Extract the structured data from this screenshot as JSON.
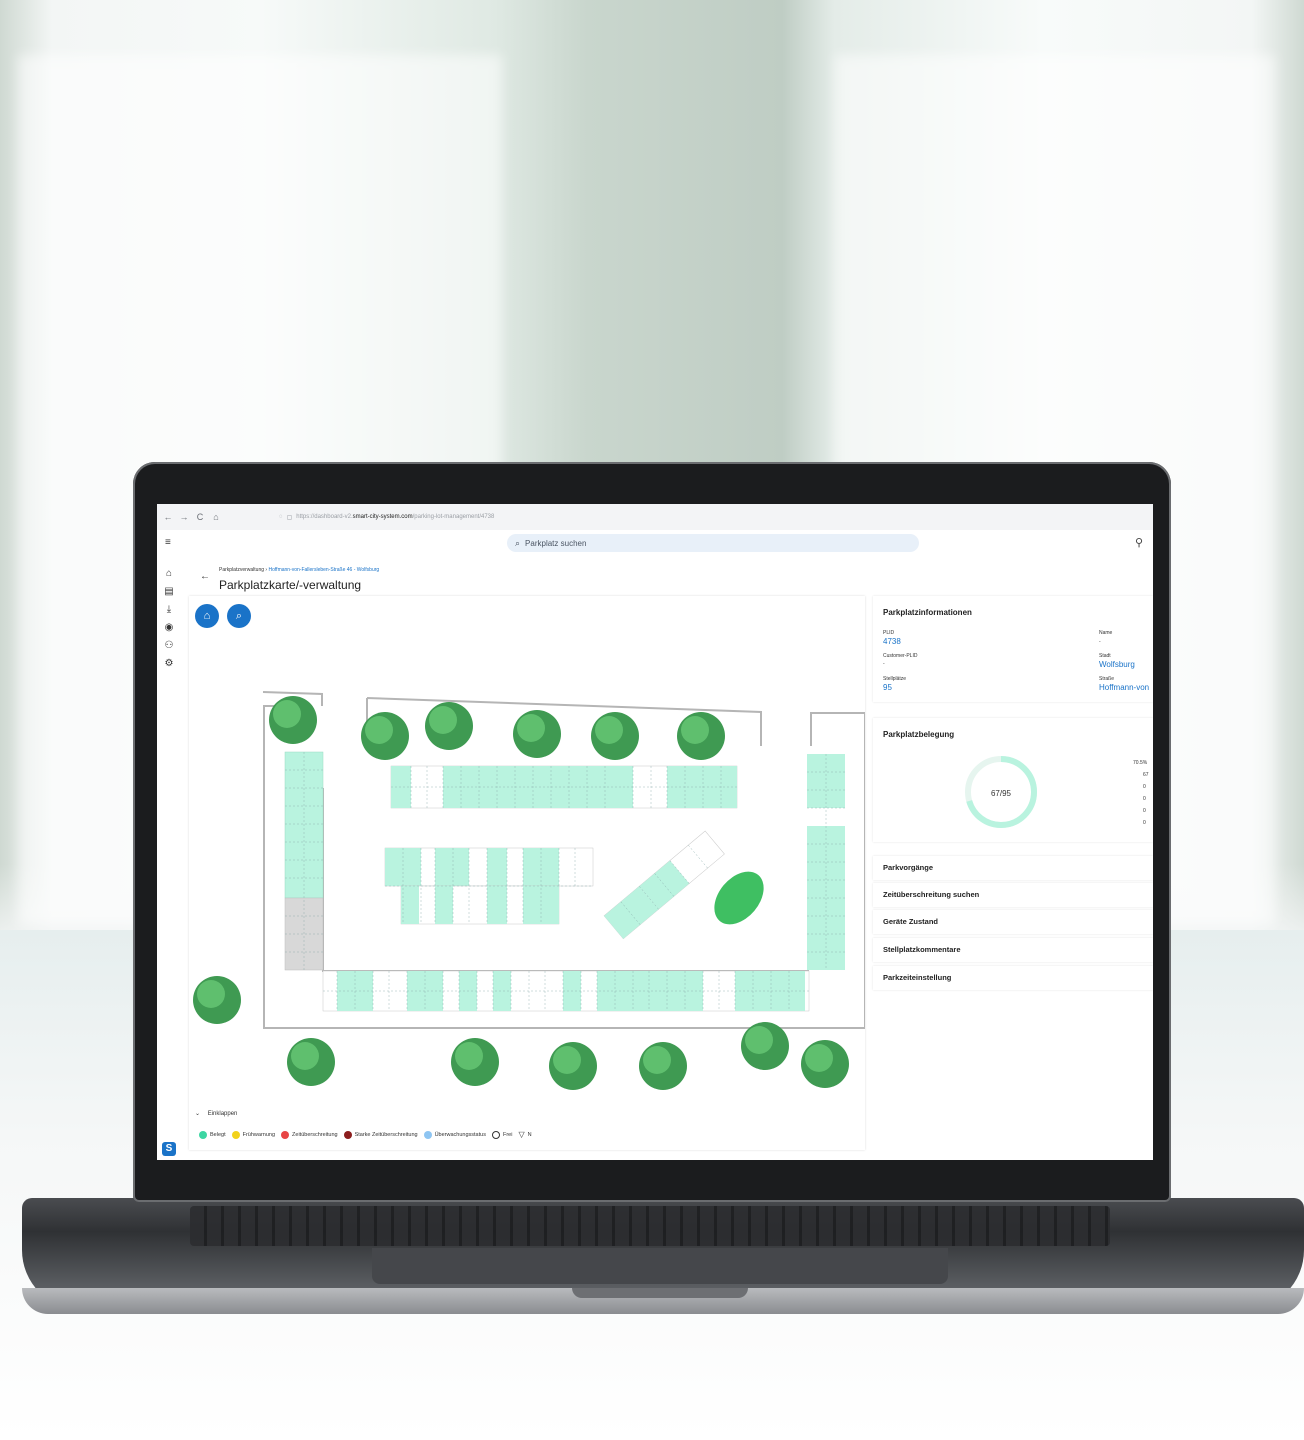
{
  "browser": {
    "url_prefix": "https://dashboard-v2.",
    "url_host": "smart-city-system.com",
    "url_path": "/parking-lot-management/4738",
    "nav_back": "←",
    "nav_forward": "→",
    "nav_reload": "C",
    "nav_home": "⌂"
  },
  "header": {
    "search_placeholder": "Parkplatz suchen"
  },
  "breadcrumb": {
    "root": "Parkplatzverwaltung",
    "separator": "›",
    "current": "Hoffmann-von-Fallersleben-Straße 46 - Wolfsburg"
  },
  "page_title": "Parkplatzkarte/-verwaltung",
  "map": {
    "collapse_label": "Einklappen",
    "legend": [
      {
        "label": "Belegt",
        "color": "#3dd6a3"
      },
      {
        "label": "Frühwarnung",
        "color": "#f2d21b"
      },
      {
        "label": "Zeitüberschreitung",
        "color": "#e84545"
      },
      {
        "label": "Starke Zeitüberschreitung",
        "color": "#8b1d1d"
      },
      {
        "label": "Überwachungsstatus",
        "color": "#8ec5f2"
      },
      {
        "label": "Frei",
        "color": "#ffffff"
      }
    ],
    "compass_label": "N"
  },
  "info": {
    "title": "Parkplatzinformationen",
    "plid_label": "PLID",
    "plid_value": "4738",
    "name_label": "Name",
    "name_value": "-",
    "customer_plid_label": "Customer-PLID",
    "customer_plid_value": "-",
    "city_label": "Stadt",
    "city_value": "Wolfsburg",
    "spaces_label": "Stellplätze",
    "spaces_value": "95",
    "street_label": "Straße",
    "street_value": "Hoffmann-von"
  },
  "occupancy": {
    "title": "Parkplatzbelegung",
    "donut_label": "67/95",
    "occupied": 67,
    "total": 95,
    "pct": "70.5%",
    "counts": [
      "67",
      "0",
      "0",
      "0",
      "0"
    ]
  },
  "accordions": [
    "Parkvorgänge",
    "Zeitüberschreitung suchen",
    "Geräte Zustand",
    "Stellplatzkommentare",
    "Parkzeiteinstellung"
  ],
  "colors": {
    "occupied": "#b9f3df",
    "accent": "#1a73c8",
    "tree": "#3f9a52"
  }
}
